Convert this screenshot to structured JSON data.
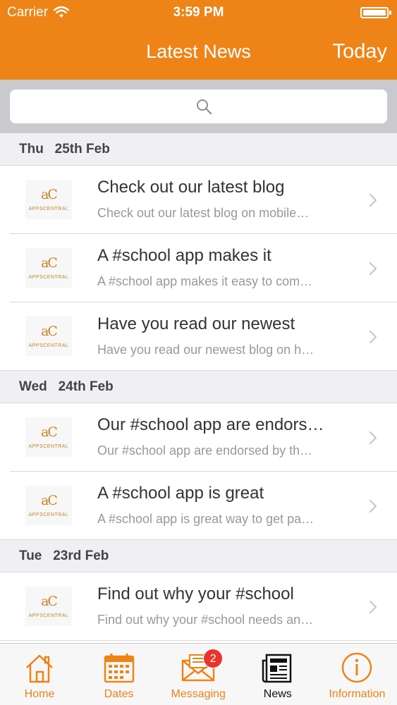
{
  "status_bar": {
    "carrier": "Carrier",
    "time": "3:59 PM"
  },
  "nav": {
    "title": "Latest News",
    "right_button": "Today"
  },
  "colors": {
    "accent": "#ee8418",
    "badge": "#e8342a"
  },
  "news": {
    "sections": [
      {
        "day": "Thu",
        "date": "25th Feb",
        "items": [
          {
            "title": "Check out our latest blog",
            "subtitle": "Check out our latest blog on mobile…"
          },
          {
            "title": "A #school app makes it",
            "subtitle": "A #school app makes it easy to com…"
          },
          {
            "title": "Have you read our newest",
            "subtitle": "Have you read our newest blog on h…"
          }
        ]
      },
      {
        "day": "Wed",
        "date": "24th Feb",
        "items": [
          {
            "title": "Our #school app are endors…",
            "subtitle": "Our #school app are endorsed by th…"
          },
          {
            "title": "A #school app is great",
            "subtitle": "A #school app is great way to get pa…"
          }
        ]
      },
      {
        "day": "Tue",
        "date": "23rd Feb",
        "items": [
          {
            "title": "Find out why your #school",
            "subtitle": "Find out why your #school needs an…"
          }
        ]
      }
    ]
  },
  "tabs": [
    {
      "label": "Home",
      "icon": "home-icon"
    },
    {
      "label": "Dates",
      "icon": "calendar-icon"
    },
    {
      "label": "Messaging",
      "icon": "envelope-icon",
      "badge": "2"
    },
    {
      "label": "News",
      "icon": "newspaper-icon",
      "active": true
    },
    {
      "label": "Information",
      "icon": "info-icon"
    }
  ]
}
